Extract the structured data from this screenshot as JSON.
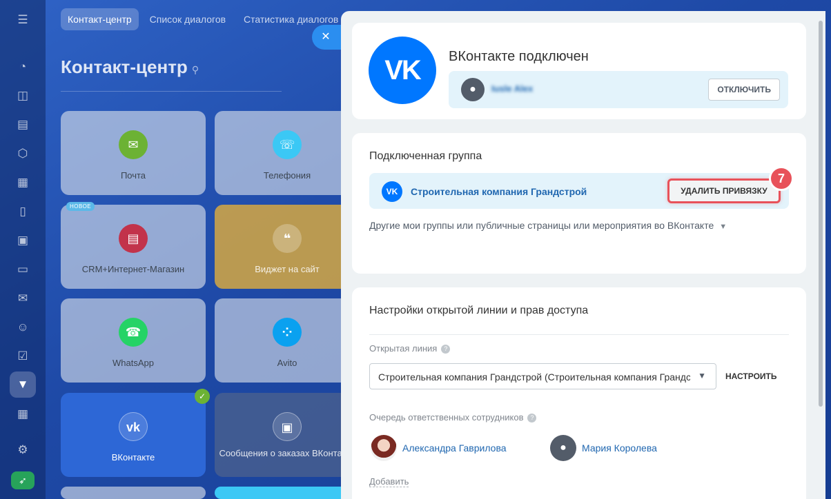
{
  "background": {
    "tabs": [
      "Контакт-центр",
      "Список диалогов",
      "Статистика диалогов"
    ],
    "page_title": "Контакт-центр",
    "tiles": [
      {
        "label": "Почта",
        "icon": "mail-icon",
        "color": "#6cb234"
      },
      {
        "label": "Телефония",
        "icon": "phone-icon",
        "color": "#3bc8f5"
      },
      {
        "label": "CRM+Интернет-Магазин",
        "icon": "shop-icon",
        "color": "#c2334b",
        "badge": "НОВОЕ"
      },
      {
        "label": "Виджет на сайт",
        "icon": "chat-icon",
        "color": "#d9a64a"
      },
      {
        "label": "WhatsApp",
        "icon": "whatsapp-icon",
        "color": "#25d366"
      },
      {
        "label": "Avito",
        "icon": "avito-icon",
        "color": "#0aa1f0"
      },
      {
        "label": "ВКонтакте",
        "icon": "vk-icon",
        "color": "#2d67d6"
      },
      {
        "label": "Сообщения о заказах ВКонтакте",
        "icon": "vk-bag-icon",
        "color": "#50648c"
      }
    ]
  },
  "panel": {
    "close_icon": "✕",
    "connected_title": "ВКонтакте подключен",
    "vk_logo_text": "VK",
    "account_name": "Iusle Alex",
    "disconnect_label": "ОТКЛЮЧИТЬ",
    "group_section_title": "Подключенная группа",
    "group_name": "Строительная компания Грандстрой",
    "unlink_label": "УДАЛИТЬ ПРИВЯЗКУ",
    "step_number": "7",
    "other_groups": "Другие мои группы или публичные страницы или мероприятия во ВКонтакте",
    "settings_title": "Настройки открытой линии и прав доступа",
    "open_line_label": "Открытая линия",
    "open_line_value": "Строительная компания Грандстрой (Строительная компания Грандстрой)",
    "configure_label": "НАСТРОИТЬ",
    "queue_label": "Очередь ответственных сотрудников",
    "queue": [
      "Александра Гаврилова",
      "Мария Королева"
    ],
    "add_label": "Добавить"
  },
  "colors": {
    "vk_blue": "#0077ff",
    "highlight_red": "#e8525a",
    "link_blue": "#2067b0"
  }
}
